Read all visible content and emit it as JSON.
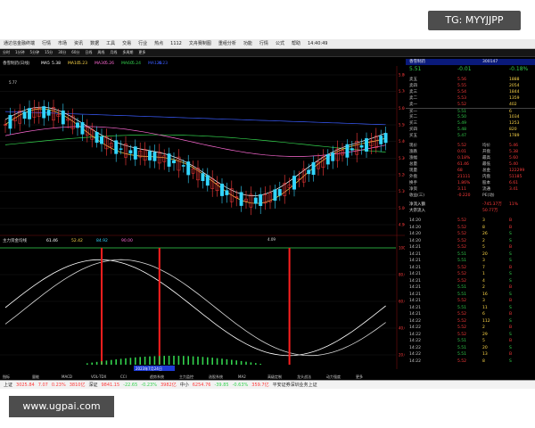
{
  "watermarks": {
    "top": "TG: MYYJJPP",
    "bottom": "www.ugpai.com"
  },
  "menubar": {
    "items": [
      "通达信金融终端",
      "行情",
      "市场",
      "资讯",
      "数据",
      "工具",
      "交易",
      "行业",
      "热点",
      "1112",
      "文舟赛制图",
      "重组分析",
      "功能",
      "行情",
      "公式",
      "帮助",
      "14:40:49"
    ]
  },
  "toolbar": {
    "items": [
      "分时",
      "1分钟",
      "5分钟",
      "15分",
      "30分",
      "60分",
      "日线",
      "周线",
      "月线",
      "多周期",
      "更多"
    ]
  },
  "chart": {
    "title": "香雪制药(日线)",
    "ma": [
      {
        "label": "MA5",
        "value": "5.38"
      },
      {
        "label": "MA10",
        "value": "5.23"
      },
      {
        "label": "MA30",
        "value": "5.26"
      },
      {
        "label": "MA60",
        "value": "5.24"
      },
      {
        "label": "MA120",
        "value": "6.23"
      }
    ],
    "high_label": "5.77",
    "low_label": "4.09",
    "lower_title": "主力资金均线",
    "lower_values": [
      "61.46",
      "52.42",
      "84.92",
      "90.00"
    ],
    "date_label": "2023年7月24日",
    "yaxis": [
      "5.80",
      "5.70",
      "5.60",
      "5.50",
      "5.40",
      "5.30",
      "5.20",
      "5.10",
      "5.00",
      "4.90"
    ],
    "lower_yaxis": [
      "100.00",
      "80.00",
      "60.00",
      "40.00",
      "20.00"
    ],
    "tabs": [
      "指标",
      "量能",
      "MACD",
      "VOL-TDX",
      "CCI",
      "趋势系统",
      "主力监控",
      "选股系统",
      "MA2",
      "高级定制",
      "龙头战法",
      "动力强度",
      "更多"
    ]
  },
  "stock": {
    "name": "香雪制药",
    "code": "300147",
    "price": "5.51",
    "change": "-0.01",
    "pct": "-0.18%"
  },
  "orderbook": [
    {
      "label": "卖五",
      "price": "5.56",
      "vol": "1888"
    },
    {
      "label": "卖四",
      "price": "5.55",
      "vol": "2054"
    },
    {
      "label": "卖三",
      "price": "5.54",
      "vol": "1844"
    },
    {
      "label": "卖二",
      "price": "5.53",
      "vol": "1359"
    },
    {
      "label": "卖一",
      "price": "5.52",
      "vol": "402"
    },
    {
      "label": "买一",
      "price": "5.51",
      "vol": "6"
    },
    {
      "label": "买二",
      "price": "5.50",
      "vol": "1034"
    },
    {
      "label": "买三",
      "price": "5.49",
      "vol": "1253"
    },
    {
      "label": "买四",
      "price": "5.48",
      "vol": "820"
    },
    {
      "label": "买五",
      "price": "5.47",
      "vol": "1789"
    }
  ],
  "stats": [
    [
      "现价",
      "5.52",
      "均价",
      "5.46"
    ],
    [
      "涨跌",
      "0.01",
      "开盘",
      "5.38"
    ],
    [
      "涨幅",
      "0.18%",
      "最高",
      "5.60"
    ],
    [
      "总量",
      "61.46",
      "最低",
      "5.40"
    ],
    [
      "现量",
      "68",
      "总金",
      "122299"
    ],
    [
      "外盘",
      "21111",
      "内盘",
      "51185"
    ],
    [
      "换手",
      "1.86%",
      "股本",
      "6.61"
    ],
    [
      "净资",
      "3.11",
      "流通",
      "3.41"
    ],
    [
      "收益(三)",
      "-0.220",
      "PE(动)",
      ""
    ]
  ],
  "flow": [
    {
      "label": "净流入额",
      "value": "-745.37万",
      "extra": "11%"
    },
    {
      "label": "大宗流入",
      "value": "50.77万",
      "extra": ""
    }
  ],
  "ticks": [
    [
      "14:20",
      "5.52",
      "3",
      "B"
    ],
    [
      "14:20",
      "5.52",
      "8",
      "B"
    ],
    [
      "14:20",
      "5.52",
      "26",
      "S"
    ],
    [
      "14:20",
      "5.52",
      "2",
      "S"
    ],
    [
      "14:21",
      "5.52",
      "5",
      "B"
    ],
    [
      "14:21",
      "5.51",
      "20",
      "S"
    ],
    [
      "14:21",
      "5.51",
      "3",
      "S"
    ],
    [
      "14:21",
      "5.52",
      "7",
      "B"
    ],
    [
      "14:21",
      "5.52",
      "1",
      "S"
    ],
    [
      "14:21",
      "5.52",
      "4",
      "S"
    ],
    [
      "14:21",
      "5.51",
      "2",
      "B"
    ],
    [
      "14:21",
      "5.51",
      "16",
      "S"
    ],
    [
      "14:21",
      "5.52",
      "3",
      "B"
    ],
    [
      "14:21",
      "5.51",
      "11",
      "S"
    ],
    [
      "14:21",
      "5.52",
      "6",
      "B"
    ],
    [
      "14:22",
      "5.52",
      "112",
      "S"
    ],
    [
      "14:22",
      "5.52",
      "2",
      "B"
    ],
    [
      "14:22",
      "5.52",
      "29",
      "S"
    ],
    [
      "14:22",
      "5.51",
      "5",
      "B"
    ],
    [
      "14:22",
      "5.51",
      "20",
      "S"
    ],
    [
      "14:22",
      "5.51",
      "13",
      "B"
    ],
    [
      "14:22",
      "5.52",
      "8",
      "S"
    ]
  ],
  "statusbar": {
    "items": [
      "上证",
      "3025.84",
      "7.07",
      "0.23%",
      "3810亿",
      "深证",
      "9841.15",
      "-22.65",
      "-0.23%",
      "3982亿",
      "中小",
      "6254.76",
      "-39.85",
      "-0.63%",
      "359.7亿",
      "平安证券深圳业务上证"
    ]
  },
  "colors": {
    "up": "#ff3b3b",
    "down": "#33d6ff",
    "bg": "#000000",
    "ma5": "#ffffff",
    "ma10": "#ffd84a",
    "ma30": "#ff6ad5",
    "ma60": "#33d24d",
    "ma120": "#3a5cff"
  }
}
